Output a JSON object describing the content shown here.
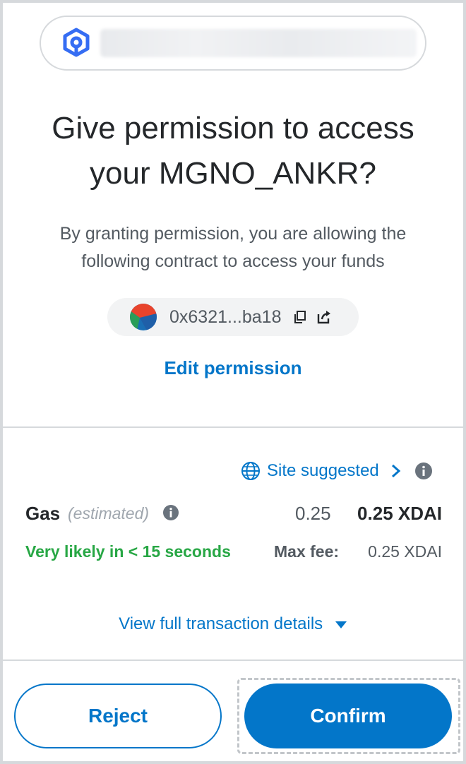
{
  "title_line1": "Give permission to access",
  "title_line2": "your MGNO_ANKR?",
  "subtitle_line1": "By granting permission, you are allowing the",
  "subtitle_line2": "following contract to access your funds",
  "contract_address": "0x6321...ba18",
  "edit_permission": "Edit permission",
  "site_suggested": "Site suggested",
  "gas": {
    "label": "Gas",
    "estimated": "(estimated)",
    "fiat": "0.25",
    "native": "0.25 XDAI",
    "likely": "Very likely in < 15 seconds",
    "max_fee_label": "Max fee:",
    "max_fee_value": "0.25 XDAI"
  },
  "view_details": "View full transaction details",
  "buttons": {
    "reject": "Reject",
    "confirm": "Confirm"
  },
  "colors": {
    "accent": "#0376c9",
    "success": "#28a745",
    "text": "#24272a",
    "muted": "#535a61"
  },
  "icons": [
    "ankr-logo-icon",
    "copy-icon",
    "external-link-icon",
    "globe-icon",
    "chevron-right-icon",
    "info-icon",
    "caret-down-icon"
  ]
}
